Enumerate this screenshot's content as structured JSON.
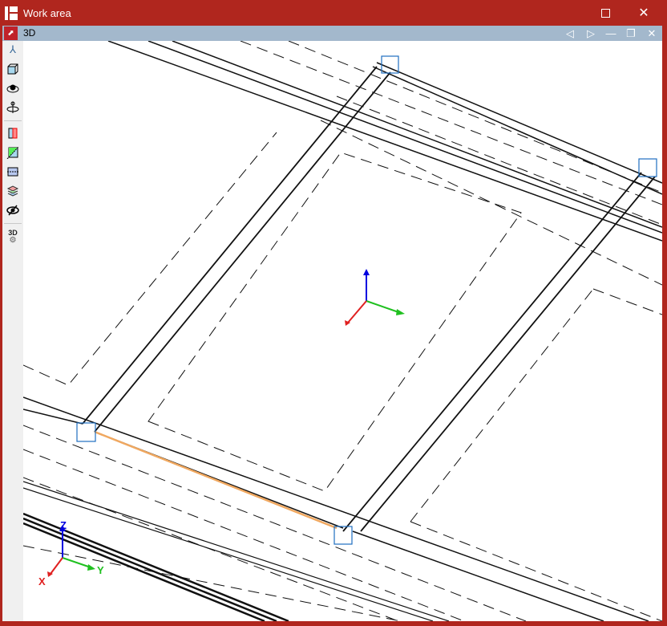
{
  "window": {
    "title": "Work area",
    "maximize_icon": "maximize-icon",
    "close_icon": "close-icon"
  },
  "view": {
    "title": "3D",
    "buttons": [
      "previous-icon",
      "next-icon",
      "minimize-icon",
      "restore-icon",
      "close-icon"
    ]
  },
  "toolbar": {
    "items": [
      "axes-icon",
      "cube-view-icon",
      "orbit-icon",
      "rotate-icon",
      "section-red-icon",
      "section-green-icon",
      "section-plane-icon",
      "layers-icon",
      "visibility-icon",
      "3d-settings-icon"
    ],
    "settings_label": "3D"
  },
  "axes": {
    "x": "X",
    "y": "Y",
    "z": "Z"
  },
  "colors": {
    "frame": "#b0261e",
    "viewbar": "#a3b8cc",
    "selected_edge": "#f0a860",
    "node_box": "#1f6fc0"
  }
}
